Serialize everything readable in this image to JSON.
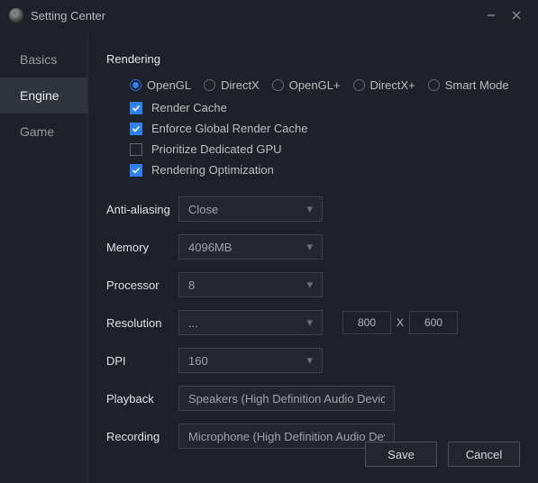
{
  "window": {
    "title": "Setting Center",
    "minimize_semantic": "minimize",
    "close_semantic": "close"
  },
  "sidebar": {
    "items": [
      {
        "label": "Basics",
        "active": false
      },
      {
        "label": "Engine",
        "active": true
      },
      {
        "label": "Game",
        "active": false
      }
    ]
  },
  "rendering": {
    "title": "Rendering",
    "modes": [
      {
        "label": "OpenGL",
        "selected": true
      },
      {
        "label": "DirectX",
        "selected": false
      },
      {
        "label": "OpenGL+",
        "selected": false
      },
      {
        "label": "DirectX+",
        "selected": false
      },
      {
        "label": "Smart Mode",
        "selected": false
      }
    ],
    "checks": [
      {
        "label": "Render Cache",
        "checked": true
      },
      {
        "label": "Enforce Global Render Cache",
        "checked": true
      },
      {
        "label": "Prioritize Dedicated GPU",
        "checked": false
      },
      {
        "label": "Rendering Optimization",
        "checked": true
      }
    ]
  },
  "form": {
    "antialiasing": {
      "label": "Anti-aliasing",
      "value": "Close"
    },
    "memory": {
      "label": "Memory",
      "value": "4096MB"
    },
    "processor": {
      "label": "Processor",
      "value": "8"
    },
    "resolution": {
      "label": "Resolution",
      "value": "...",
      "width": "800",
      "sep": "X",
      "height": "600"
    },
    "dpi": {
      "label": "DPI",
      "value": "160"
    },
    "playback": {
      "label": "Playback",
      "value": "Speakers (High Definition Audio Device)"
    },
    "recording": {
      "label": "Recording",
      "value": "Microphone (High Definition Audio Dev"
    }
  },
  "footer": {
    "save": "Save",
    "cancel": "Cancel"
  }
}
